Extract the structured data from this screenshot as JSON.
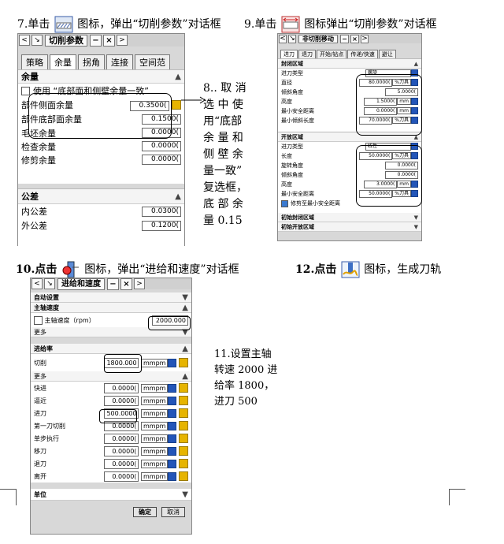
{
  "captions": {
    "c7_pre": "7.单击",
    "c7_post": "图标，弹出“切削参数”对话框",
    "c9_pre": "9.单击",
    "c9_post": "图标弹出“切削参数”对话框",
    "c10_pre": "10.点击",
    "c10_post": "图标，弹出“进给和速度”对话框",
    "c12_pre": "12.点击",
    "c12_post": "图标，生成刀轨"
  },
  "note8": [
    "8.. 取 消",
    "选 中 使",
    "用“底部",
    "余 量 和",
    "侧 壁 余",
    "量一致”",
    "复选框，",
    "底 部 余",
    "量 0.15"
  ],
  "note11": [
    "11.设置主轴",
    "转速 2000 进",
    "给率 1800，",
    "进刀 500"
  ],
  "dlg1": {
    "title": "切削参数",
    "tabs": [
      "策略",
      "余量",
      "拐角",
      "连接",
      "空间范"
    ],
    "sec1": "余量",
    "checkbox_label": "使用 “底部面和侧壁余量一致”",
    "rows": [
      {
        "label": "部件侧面余量",
        "value": "0.3500("
      },
      {
        "label": "部件底部面余量",
        "value": "0.1500("
      },
      {
        "label": "毛坯余量",
        "value": "0.0000("
      },
      {
        "label": "检查余量",
        "value": "0.0000("
      },
      {
        "label": "修剪余量",
        "value": "0.0000("
      }
    ],
    "sec2": "公差",
    "tol": [
      {
        "label": "内公差",
        "value": "0.0300("
      },
      {
        "label": "外公差",
        "value": "0.1200("
      }
    ]
  },
  "dlg2": {
    "title": "非切削移动",
    "tabs": [
      "进刀",
      "退刀",
      "开始/钻点",
      "传递/快速",
      "避让"
    ],
    "sec1": "封闭区域",
    "closed": [
      {
        "label": "进刀类型",
        "value": "螺旋",
        "unit": ""
      },
      {
        "label": "直径",
        "value": "80.0000(",
        "unit": "%刀具"
      },
      {
        "label": "倾斜角度",
        "value": "5.0000(",
        "unit": ""
      },
      {
        "label": "高度",
        "value": "1.5000(",
        "unit": "mm"
      },
      {
        "label": "最小安全距离",
        "value": "0.0000(",
        "unit": "mm"
      },
      {
        "label": "最小倾斜长度",
        "value": "70.0000(",
        "unit": "%刀具"
      }
    ],
    "sec2": "开放区域",
    "open": [
      {
        "label": "进刀类型",
        "value": "线性",
        "unit": ""
      },
      {
        "label": "长度",
        "value": "50.0000(",
        "unit": "%刀具"
      },
      {
        "label": "旋转角度",
        "value": "0.0000(",
        "unit": ""
      },
      {
        "label": "倾斜角度",
        "value": "0.0000(",
        "unit": ""
      },
      {
        "label": "高度",
        "value": "3.0000(",
        "unit": "mm"
      },
      {
        "label": "最小安全距离",
        "value": "50.0000(",
        "unit": "%刀具"
      }
    ],
    "checkbox_label": "修剪至最小安全距离",
    "sec3": "初始封闭区域",
    "sec4": "初始开放区域"
  },
  "dlg3": {
    "title": "进给和速度",
    "s_auto": "自动设置",
    "s_spindle": "主轴速度",
    "spindle_label": "主轴速度（rpm）",
    "spindle_value": "2000.000",
    "more": "更多",
    "s_feed": "进给率",
    "cut_label": "切削",
    "cut_value": "1800.000",
    "cut_unit": "mmpm",
    "more2": "更多",
    "feeds": [
      {
        "label": "快进",
        "value": "0.0000(",
        "unit": "mmpm"
      },
      {
        "label": "逼近",
        "value": "0.0000(",
        "unit": "mmpm"
      },
      {
        "label": "进刀",
        "value": "500.0000",
        "unit": "mmpm"
      },
      {
        "label": "第一刀切削",
        "value": "0.0000(",
        "unit": "mmpm"
      },
      {
        "label": "单步执行",
        "value": "0.0000(",
        "unit": "mmpm"
      },
      {
        "label": "移刀",
        "value": "0.0000(",
        "unit": "mmpm"
      },
      {
        "label": "退刀",
        "value": "0.0000(",
        "unit": "mmpm"
      },
      {
        "label": "离开",
        "value": "0.0000(",
        "unit": "mmpm"
      }
    ],
    "s_unit": "单位",
    "ok": "确定",
    "cancel": "取消"
  }
}
